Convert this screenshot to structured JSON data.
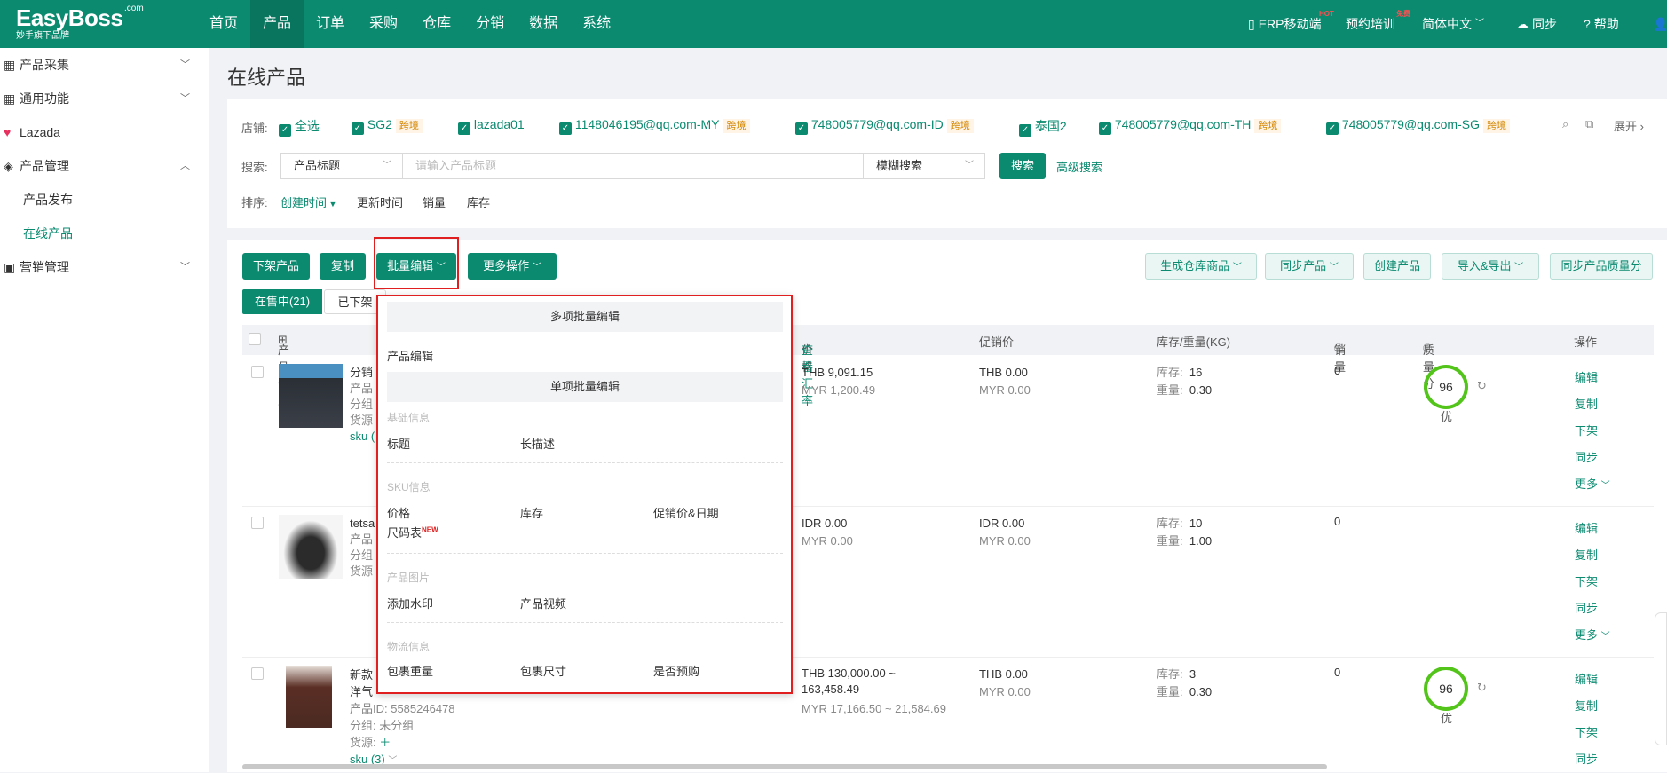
{
  "app": {
    "logo": "EasyBoss",
    "logo_com": ".com",
    "logo_sub": "妙手旗下品牌"
  },
  "nav": [
    "首页",
    "产品",
    "订单",
    "采购",
    "仓库",
    "分销",
    "数据",
    "系统"
  ],
  "topright": {
    "erp": "ERP移动端",
    "erp_badge": "HOT",
    "train": "预约培训",
    "train_badge": "免费",
    "lang": "简体中文",
    "sync": "同步",
    "help": "帮助"
  },
  "sidebar": {
    "collect": "产品采集",
    "common": "通用功能",
    "lazada": "Lazada",
    "product_mgmt": "产品管理",
    "publish": "产品发布",
    "online": "在线产品",
    "marketing": "营销管理"
  },
  "page_title": "在线产品",
  "filter": {
    "store_label": "店铺:",
    "select_all": "全选",
    "stores": [
      {
        "name": "SG2",
        "tag": "跨境"
      },
      {
        "name": "lazada01",
        "tag": ""
      },
      {
        "name": "1148046195@qq.com-MY",
        "tag": "跨境"
      },
      {
        "name": "748005779@qq.com-ID",
        "tag": "跨境"
      },
      {
        "name": "泰国2",
        "tag": ""
      },
      {
        "name": "748005779@qq.com-TH",
        "tag": "跨境"
      },
      {
        "name": "748005779@qq.com-SG",
        "tag": "跨境"
      }
    ],
    "expand": "展开",
    "search_label": "搜索:",
    "search_field": "产品标题",
    "search_placeholder": "请输入产品标题",
    "search_mode": "模糊搜索",
    "search_btn": "搜索",
    "adv_search": "高级搜索",
    "sort_label": "排序:",
    "sort_create": "创建时间",
    "sort_update": "更新时间",
    "sort_sales": "销量",
    "sort_stock": "库存"
  },
  "toolbar": {
    "delist": "下架产品",
    "copy": "复制",
    "batch_edit": "批量编辑",
    "more_ops": "更多操作",
    "gen_wh": "生成仓库商品",
    "sync_product": "同步产品",
    "create": "创建产品",
    "import_export": "导入&导出",
    "sync_quality": "同步产品质量分"
  },
  "tabs": {
    "on_sale": "在售中(21)",
    "delisted": "已下架"
  },
  "table": {
    "headers": {
      "info": "产品信息",
      "price": "价格",
      "rate": "查看汇率",
      "promo": "促销价",
      "stock": "库存/重量(KG)",
      "sales": "销量",
      "quality": "质量分",
      "ops": "操作"
    },
    "rows": [
      {
        "title": "分销",
        "l1": "产品",
        "l2": "分组",
        "l3": "货源",
        "sku": "sku (",
        "price1": "THB 9,091.15",
        "price2": "MYR 1,200.49",
        "promo1": "THB 0.00",
        "promo2": "MYR 0.00",
        "stock": "16",
        "weight": "0.30",
        "sales": "0",
        "score": "96",
        "grade": "优"
      },
      {
        "title": "tetsa",
        "l1": "产品",
        "l2": "分组",
        "l3": "货源",
        "sku": "",
        "price1": "IDR 0.00",
        "price2": "MYR 0.00",
        "promo1": "IDR 0.00",
        "promo2": "MYR 0.00",
        "stock": "10",
        "weight": "1.00",
        "sales": "0",
        "score": "",
        "grade": ""
      },
      {
        "title": "新款",
        "title2": "洋气",
        "l1": "产品ID: 5585246478",
        "l2": "分组: 未分组",
        "l3": "货源:",
        "sku": "sku (3)",
        "price1": "THB 130,000.00 ~",
        "price1b": "163,458.49",
        "price2": "MYR 17,166.50 ~ 21,584.69",
        "promo1": "THB 0.00",
        "promo2": "MYR 0.00",
        "stock": "3",
        "weight": "0.30",
        "sales": "0",
        "score": "96",
        "grade": "优"
      }
    ],
    "stock_label": "库存:",
    "weight_label": "重量:",
    "ops": {
      "edit": "编辑",
      "copy": "复制",
      "delist": "下架",
      "sync": "同步",
      "more": "更多"
    }
  },
  "dropdown": {
    "multi": "多项批量编辑",
    "product_edit": "产品编辑",
    "single": "单项批量编辑",
    "basic": "基础信息",
    "title": "标题",
    "long_desc": "长描述",
    "sku_info": "SKU信息",
    "price": "价格",
    "stock": "库存",
    "promo_date": "促销价&日期",
    "size_chart": "尺码表",
    "new": "NEW",
    "images": "产品图片",
    "watermark": "添加水印",
    "video": "产品视频",
    "logistics": "物流信息",
    "pkg_weight": "包裹重量",
    "pkg_size": "包裹尺寸",
    "preorder": "是否预购"
  },
  "colors": {
    "brand": "#0b8a70",
    "highlight": "#e02020"
  }
}
